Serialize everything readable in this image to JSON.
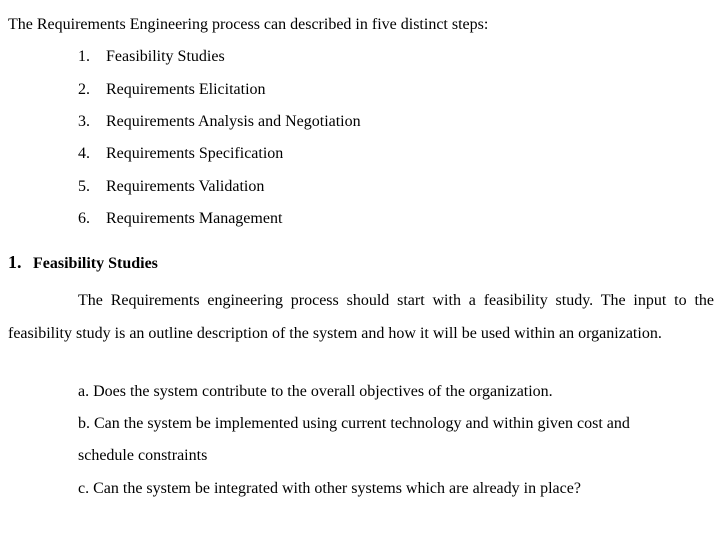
{
  "intro": "The Requirements Engineering process can described in five distinct steps:",
  "steps": [
    {
      "num": "1.",
      "label": "Feasibility Studies"
    },
    {
      "num": "2.",
      "label": "Requirements Elicitation"
    },
    {
      "num": "3.",
      "label": "Requirements Analysis and Negotiation"
    },
    {
      "num": "4.",
      "label": "Requirements Specification"
    },
    {
      "num": "5.",
      "label": "Requirements Validation"
    },
    {
      "num": "6.",
      "label": "Requirements Management"
    }
  ],
  "section": {
    "num": "1.",
    "title": "Feasibility Studies",
    "paragraph": "The Requirements engineering process should start with a feasibility study. The input to the feasibility study is an outline description of the system and how it will be used within an organization.",
    "questions": [
      "a. Does the system contribute to the overall objectives of the organization.",
      "b. Can the system be implemented using current technology and within given cost and",
      "schedule constraints",
      "c. Can the system be integrated with other systems which are already in place?"
    ]
  }
}
